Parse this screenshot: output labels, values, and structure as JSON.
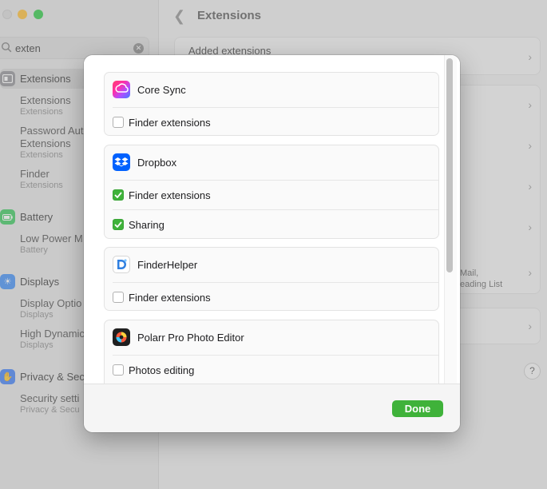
{
  "window": {
    "title": "Extensions",
    "search": {
      "value": "exten"
    },
    "sidebar": {
      "categories": [
        {
          "label": "Extensions",
          "color": "#8e8e93",
          "icon": "extensions-icon"
        },
        {
          "label": "Battery",
          "color": "#34c759",
          "icon": "battery-icon"
        },
        {
          "label": "Displays",
          "color": "#3a8bf5",
          "icon": "displays-icon"
        },
        {
          "label": "Privacy & Sec",
          "color": "#3a7bf5",
          "icon": "hand-icon"
        }
      ],
      "results": [
        {
          "title": "Extensions",
          "caption": "Extensions"
        },
        {
          "title": "Password Aut",
          "title2": "Extensions",
          "caption": "Extensions"
        },
        {
          "title": "Finder",
          "caption": "Extensions"
        },
        {
          "title": "Low Power M",
          "caption": "Battery"
        },
        {
          "title": "Display Optio",
          "caption": "Displays"
        },
        {
          "title": "High Dynamic",
          "caption": "Displays"
        },
        {
          "title": "Security setti",
          "caption": "Privacy & Secu"
        }
      ]
    },
    "main": {
      "added_label": "Added extensions",
      "mail_line1": "Mail,",
      "mail_line2": "eading List",
      "help": "?"
    }
  },
  "sheet": {
    "groups": [
      {
        "app": "Core Sync",
        "icon": "core-sync-icon",
        "options": [
          {
            "label": "Finder extensions",
            "checked": false
          }
        ]
      },
      {
        "app": "Dropbox",
        "icon": "dropbox-icon",
        "options": [
          {
            "label": "Finder extensions",
            "checked": true
          },
          {
            "label": "Sharing",
            "checked": true
          }
        ]
      },
      {
        "app": "FinderHelper",
        "icon": "finderhelper-icon",
        "options": [
          {
            "label": "Finder extensions",
            "checked": false
          }
        ]
      },
      {
        "app": "Polarr Pro Photo Editor",
        "icon": "polarr-icon",
        "options": [
          {
            "label": "Photos editing",
            "checked": false
          }
        ]
      }
    ],
    "done_label": "Done",
    "accent": "#3fb23a"
  }
}
